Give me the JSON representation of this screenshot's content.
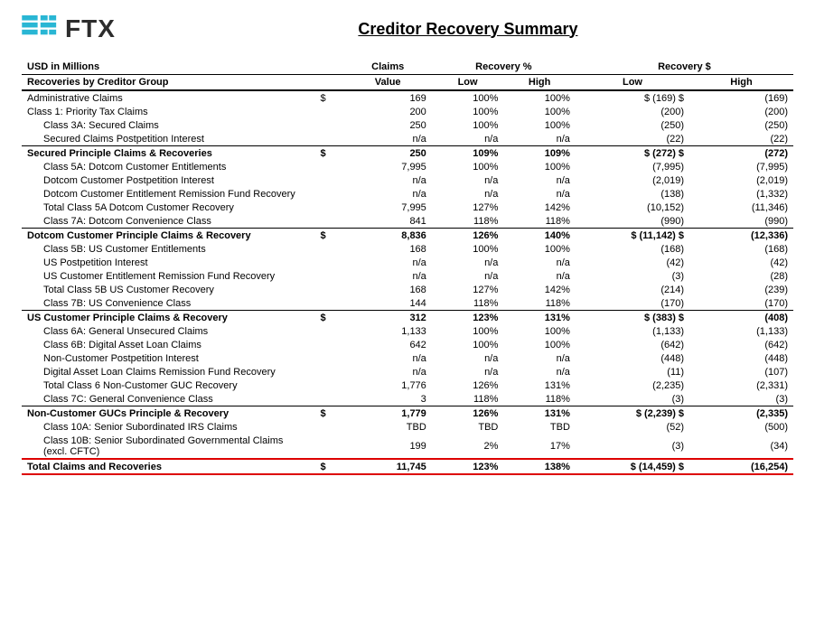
{
  "header": {
    "title": "Creditor Recovery Summary",
    "logo_text": "FTX",
    "subtitle": "USD in Millions"
  },
  "col_headers": {
    "group1": "Claims",
    "group2": "Recovery %",
    "group3": "Recovery $",
    "sub_value": "Value",
    "sub_low": "Low",
    "sub_high": "High",
    "sub_rec_low": "Low",
    "sub_rec_high": "High",
    "recoveries_label": "Recoveries by Creditor Group"
  },
  "rows": [
    {
      "type": "data",
      "label": "Administrative Claims",
      "dollar": "$",
      "value": "169",
      "low": "100%",
      "high": "100%",
      "rdollar": "$",
      "rlow": "(169) $",
      "rhigh": "(169)"
    },
    {
      "type": "data",
      "label": "Class 1: Priority Tax Claims",
      "dollar": "",
      "value": "200",
      "low": "100%",
      "high": "100%",
      "rdollar": "",
      "rlow": "(200)",
      "rhigh": "(200)"
    },
    {
      "type": "data",
      "label": "Class 3A: Secured Claims",
      "dollar": "",
      "value": "250",
      "low": "100%",
      "high": "100%",
      "rdollar": "",
      "rlow": "(250)",
      "rhigh": "(250)",
      "indent": 1
    },
    {
      "type": "data",
      "label": "Secured Claims Postpetition Interest",
      "dollar": "",
      "value": "n/a",
      "low": "n/a",
      "high": "n/a",
      "rdollar": "",
      "rlow": "(22)",
      "rhigh": "(22)",
      "indent": 1
    },
    {
      "type": "subtotal",
      "label": "Secured Principle Claims & Recoveries",
      "dollar": "$",
      "value": "250",
      "low": "109%",
      "high": "109%",
      "rdollar": "$",
      "rlow": "(272) $",
      "rhigh": "(272)"
    },
    {
      "type": "data",
      "label": "Class 5A: Dotcom Customer Entitlements",
      "dollar": "",
      "value": "7,995",
      "low": "100%",
      "high": "100%",
      "rdollar": "",
      "rlow": "(7,995)",
      "rhigh": "(7,995)",
      "indent": 1
    },
    {
      "type": "data",
      "label": "Dotcom Customer Postpetition Interest",
      "dollar": "",
      "value": "n/a",
      "low": "n/a",
      "high": "n/a",
      "rdollar": "",
      "rlow": "(2,019)",
      "rhigh": "(2,019)",
      "indent": 1
    },
    {
      "type": "data",
      "label": "Dotcom Customer Entitlement Remission Fund Recovery",
      "dollar": "",
      "value": "n/a",
      "low": "n/a",
      "high": "n/a",
      "rdollar": "",
      "rlow": "(138)",
      "rhigh": "(1,332)",
      "indent": 1
    },
    {
      "type": "data",
      "label": "Total Class 5A Dotcom Customer Recovery",
      "dollar": "",
      "value": "7,995",
      "low": "127%",
      "high": "142%",
      "rdollar": "",
      "rlow": "(10,152)",
      "rhigh": "(11,346)",
      "indent": 1
    },
    {
      "type": "data",
      "label": "Class 7A: Dotcom Convenience Class",
      "dollar": "",
      "value": "841",
      "low": "118%",
      "high": "118%",
      "rdollar": "",
      "rlow": "(990)",
      "rhigh": "(990)",
      "indent": 1
    },
    {
      "type": "subtotal",
      "label": "Dotcom Customer Principle Claims & Recovery",
      "dollar": "$",
      "value": "8,836",
      "low": "126%",
      "high": "140%",
      "rdollar": "$",
      "rlow": "(11,142) $",
      "rhigh": "(12,336)"
    },
    {
      "type": "data",
      "label": "Class 5B: US Customer Entitlements",
      "dollar": "",
      "value": "168",
      "low": "100%",
      "high": "100%",
      "rdollar": "",
      "rlow": "(168)",
      "rhigh": "(168)",
      "indent": 1
    },
    {
      "type": "data",
      "label": "US Postpetition Interest",
      "dollar": "",
      "value": "n/a",
      "low": "n/a",
      "high": "n/a",
      "rdollar": "",
      "rlow": "(42)",
      "rhigh": "(42)",
      "indent": 1
    },
    {
      "type": "data",
      "label": "US Customer Entitlement Remission Fund Recovery",
      "dollar": "",
      "value": "n/a",
      "low": "n/a",
      "high": "n/a",
      "rdollar": "",
      "rlow": "(3)",
      "rhigh": "(28)",
      "indent": 1
    },
    {
      "type": "data",
      "label": "Total Class 5B US Customer Recovery",
      "dollar": "",
      "value": "168",
      "low": "127%",
      "high": "142%",
      "rdollar": "",
      "rlow": "(214)",
      "rhigh": "(239)",
      "indent": 1
    },
    {
      "type": "data",
      "label": "Class 7B: US Convenience Class",
      "dollar": "",
      "value": "144",
      "low": "118%",
      "high": "118%",
      "rdollar": "",
      "rlow": "(170)",
      "rhigh": "(170)",
      "indent": 1
    },
    {
      "type": "subtotal",
      "label": "US Customer Principle Claims & Recovery",
      "dollar": "$",
      "value": "312",
      "low": "123%",
      "high": "131%",
      "rdollar": "$",
      "rlow": "(383) $",
      "rhigh": "(408)"
    },
    {
      "type": "data",
      "label": "Class 6A: General Unsecured Claims",
      "dollar": "",
      "value": "1,133",
      "low": "100%",
      "high": "100%",
      "rdollar": "",
      "rlow": "(1,133)",
      "rhigh": "(1,133)",
      "indent": 1
    },
    {
      "type": "data",
      "label": "Class 6B: Digital Asset Loan Claims",
      "dollar": "",
      "value": "642",
      "low": "100%",
      "high": "100%",
      "rdollar": "",
      "rlow": "(642)",
      "rhigh": "(642)",
      "indent": 1
    },
    {
      "type": "data",
      "label": "Non-Customer Postpetition Interest",
      "dollar": "",
      "value": "n/a",
      "low": "n/a",
      "high": "n/a",
      "rdollar": "",
      "rlow": "(448)",
      "rhigh": "(448)",
      "indent": 1
    },
    {
      "type": "data",
      "label": "Digital Asset Loan Claims Remission Fund Recovery",
      "dollar": "",
      "value": "n/a",
      "low": "n/a",
      "high": "n/a",
      "rdollar": "",
      "rlow": "(11)",
      "rhigh": "(107)",
      "indent": 1
    },
    {
      "type": "data",
      "label": "Total Class 6 Non-Customer GUC Recovery",
      "dollar": "",
      "value": "1,776",
      "low": "126%",
      "high": "131%",
      "rdollar": "",
      "rlow": "(2,235)",
      "rhigh": "(2,331)",
      "indent": 1
    },
    {
      "type": "data",
      "label": "Class 7C: General Convenience Class",
      "dollar": "",
      "value": "3",
      "low": "118%",
      "high": "118%",
      "rdollar": "",
      "rlow": "(3)",
      "rhigh": "(3)",
      "indent": 1
    },
    {
      "type": "subtotal",
      "label": "Non-Customer GUCs Principle & Recovery",
      "dollar": "$",
      "value": "1,779",
      "low": "126%",
      "high": "131%",
      "rdollar": "$",
      "rlow": "(2,239) $",
      "rhigh": "(2,335)"
    },
    {
      "type": "data",
      "label": "Class 10A: Senior Subordinated IRS Claims",
      "dollar": "",
      "value": "TBD",
      "low": "TBD",
      "high": "TBD",
      "rdollar": "",
      "rlow": "(52)",
      "rhigh": "(500)",
      "indent": 1
    },
    {
      "type": "data",
      "label": "Class 10B: Senior Subordinated Governmental Claims (excl. CFTC)",
      "dollar": "",
      "value": "199",
      "low": "2%",
      "high": "17%",
      "rdollar": "",
      "rlow": "(3)",
      "rhigh": "(34)",
      "indent": 1
    },
    {
      "type": "grandtotal",
      "label": "Total Claims and Recoveries",
      "dollar": "$",
      "value": "11,745",
      "low": "123%",
      "high": "138%",
      "rdollar": "$",
      "rlow": "(14,459) $",
      "rhigh": "(16,254)"
    }
  ]
}
